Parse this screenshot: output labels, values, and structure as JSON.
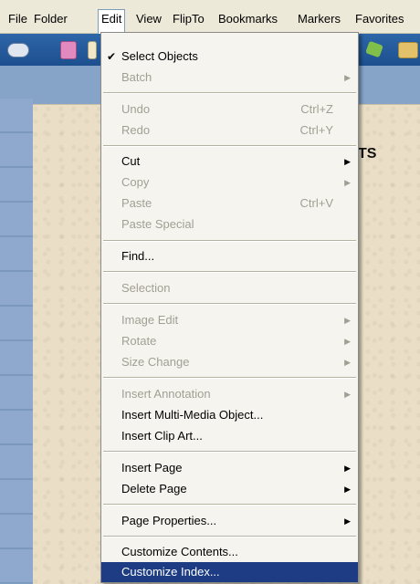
{
  "menubar": {
    "items": [
      "File",
      "Folder",
      "Edit",
      "View",
      "FlipTo",
      "Bookmarks",
      "Markers",
      "Favorites"
    ]
  },
  "document": {
    "heading_fragment": "TS"
  },
  "edit_menu": {
    "select_objects": "Select Objects",
    "batch": "Batch",
    "undo": "Undo",
    "undo_shortcut": "Ctrl+Z",
    "redo": "Redo",
    "redo_shortcut": "Ctrl+Y",
    "cut": "Cut",
    "copy": "Copy",
    "paste": "Paste",
    "paste_shortcut": "Ctrl+V",
    "paste_special": "Paste Special",
    "find": "Find...",
    "selection": "Selection",
    "image_edit": "Image Edit",
    "rotate": "Rotate",
    "size_change": "Size Change",
    "insert_annotation": "Insert Annotation",
    "insert_multimedia": "Insert Multi-Media Object...",
    "insert_clip_art": "Insert Clip Art...",
    "insert_page": "Insert Page",
    "delete_page": "Delete Page",
    "page_properties": "Page Properties...",
    "customize_contents": "Customize Contents...",
    "customize_index": "Customize Index..."
  }
}
